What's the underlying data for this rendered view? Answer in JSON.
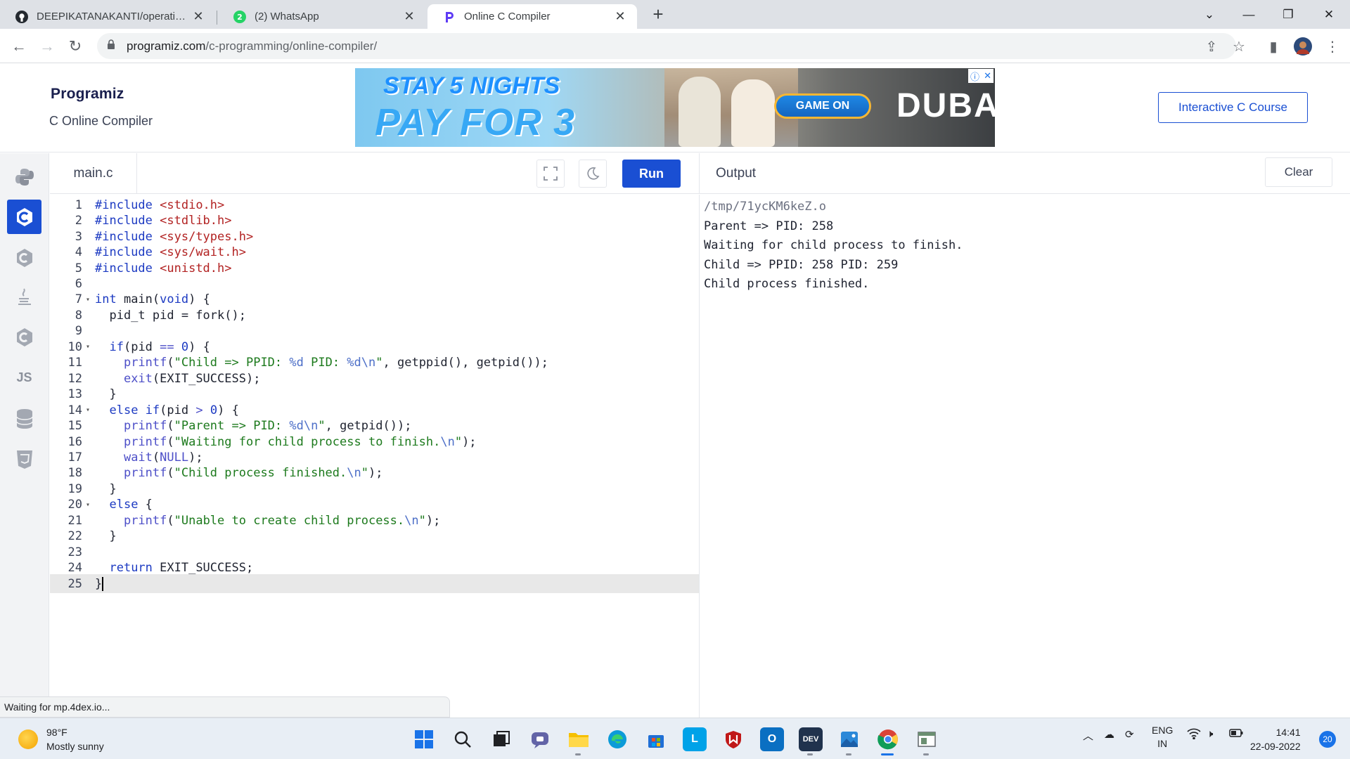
{
  "browser": {
    "tabs": [
      {
        "title": "DEEPIKATANAKANTI/operating-s",
        "icon": "github-icon"
      },
      {
        "title": "(2) WhatsApp",
        "icon": "whatsapp-icon",
        "badge": "2"
      },
      {
        "title": "Online C Compiler",
        "icon": "programiz-icon"
      }
    ],
    "url_host": "programiz.com",
    "url_path": "/c-programming/online-compiler/"
  },
  "site": {
    "logo": "Programiz",
    "subtitle": "C Online Compiler",
    "course_button": "Interactive C Course"
  },
  "ad": {
    "line1": "STAY 5 NIGHTS",
    "line2": "PAY FOR 3",
    "cta": "GAME ON",
    "brand": "DUBAI"
  },
  "languages": [
    {
      "name": "python-icon",
      "label": ""
    },
    {
      "name": "c-icon",
      "label": "C",
      "active": true
    },
    {
      "name": "cpp-icon",
      "label": ""
    },
    {
      "name": "java-icon",
      "label": ""
    },
    {
      "name": "csharp-icon",
      "label": ""
    },
    {
      "name": "js-icon",
      "label": "JS"
    },
    {
      "name": "sql-icon",
      "label": ""
    },
    {
      "name": "html-icon",
      "label": ""
    }
  ],
  "editor": {
    "filename": "main.c",
    "run_label": "Run",
    "lines": [
      "#include <stdio.h>",
      "#include <stdlib.h>",
      "#include <sys/types.h>",
      "#include <sys/wait.h>",
      "#include <unistd.h>",
      "",
      "int main(void) {",
      "  pid_t pid = fork();",
      "",
      "  if(pid == 0) {",
      "    printf(\"Child => PPID: %d PID: %d\\n\", getppid(), getpid());",
      "    exit(EXIT_SUCCESS);",
      "  }",
      "  else if(pid > 0) {",
      "    printf(\"Parent => PID: %d\\n\", getpid());",
      "    printf(\"Waiting for child process to finish.\\n\");",
      "    wait(NULL);",
      "    printf(\"Child process finished.\\n\");",
      "  }",
      "  else {",
      "    printf(\"Unable to create child process.\\n\");",
      "  }",
      "",
      "  return EXIT_SUCCESS;",
      "}"
    ],
    "fold_lines": [
      7,
      10,
      14,
      20
    ],
    "current_line": 25
  },
  "output": {
    "title": "Output",
    "clear_label": "Clear",
    "lines": [
      "/tmp/71ycKM6keZ.o",
      "Parent => PID: 258",
      "Waiting for child process to finish.",
      "Child => PPID: 258 PID: 259",
      "Child process finished."
    ]
  },
  "status_text": "Waiting for mp.4dex.io...",
  "taskbar": {
    "temperature": "98°F",
    "weather": "Mostly sunny",
    "lang_top": "ENG",
    "lang_bottom": "IN",
    "time": "14:41",
    "date": "22-09-2022",
    "notifications": "20"
  },
  "colors": {
    "accent": "#1a4fd3",
    "keyword": "#1c3ac2",
    "string": "#1d7a1d",
    "include": "#b22222"
  }
}
